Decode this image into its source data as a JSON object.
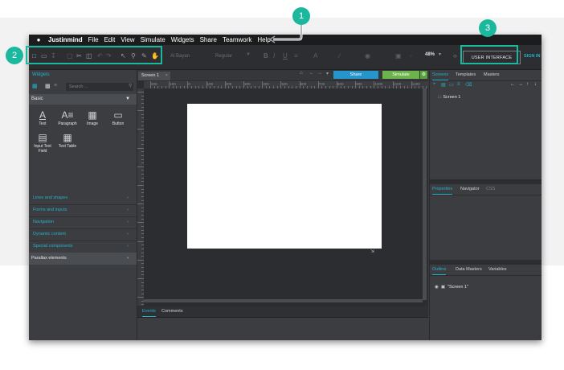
{
  "menubar": {
    "brand": "Justinmind",
    "items": [
      "File",
      "Edit",
      "View",
      "Simulate",
      "Widgets",
      "Share",
      "Teamwork",
      "Help"
    ]
  },
  "toolbar": {
    "font_name": "Al Bayan",
    "font_style": "Regular",
    "zoom": "48%",
    "ui_button": "USER INTERFACE",
    "sign_in": "SIGN IN"
  },
  "widgets_panel": {
    "title": "Widgets",
    "search_placeholder": "Search ...",
    "group": "Basic",
    "items": [
      {
        "label": "Text"
      },
      {
        "label": "Paragraph"
      },
      {
        "label": "Image"
      },
      {
        "label": "Button"
      },
      {
        "label": "Input Text Field"
      },
      {
        "label": "Text Table"
      }
    ],
    "categories": [
      "Lines and shapes",
      "Forms and inputs",
      "Navigation",
      "Dynamic content",
      "Special components"
    ],
    "parallax": "Parallax elements"
  },
  "canvas": {
    "tab": "Screen 1",
    "share": "Share",
    "simulate": "Simulate",
    "ruler_labels": [
      "200",
      "100",
      "0",
      "100",
      "200",
      "300",
      "400",
      "500",
      "600",
      "700",
      "800",
      "900",
      "1000",
      "1100",
      "1200"
    ]
  },
  "bottom_panel": {
    "tabs": [
      "Events",
      "Comments"
    ]
  },
  "right_panel": {
    "screens_tabs": [
      "Screens",
      "Templates",
      "Masters"
    ],
    "screen_item": "Screen 1",
    "properties_tabs": [
      "Properties",
      "Navigator",
      "CSS"
    ],
    "outline_tabs": [
      "Outline",
      "Data Masters",
      "Variables"
    ],
    "outline_item": "\"Screen 1\""
  },
  "callouts": {
    "one": "1",
    "two": "2",
    "three": "3"
  },
  "colors": {
    "accent": "#25b1cc",
    "callout": "#1cb89e",
    "share": "#2595cc",
    "simulate": "#6bb34a"
  }
}
